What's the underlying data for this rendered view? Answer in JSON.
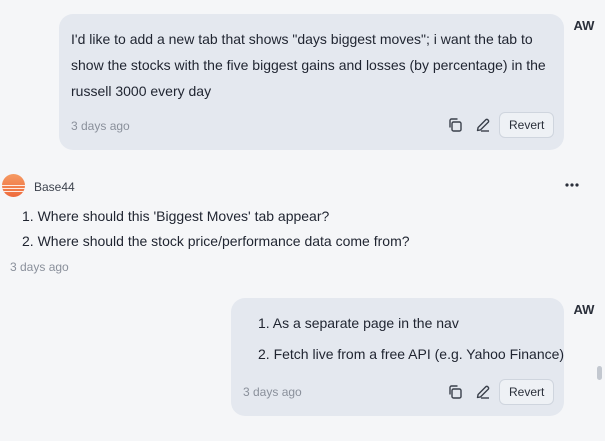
{
  "messages": [
    {
      "role": "user",
      "avatar": "AW",
      "lines": [
        "I'd like to add a new tab that shows \"days biggest moves\"; i want the tab to",
        "show the stocks with the five biggest gains and losses (by percentage) in the",
        "russell 3000 every day"
      ],
      "timestamp": "3 days ago",
      "actions": {
        "copy_icon": "copy-icon",
        "edit_icon": "pencil-icon",
        "revert_label": "Revert"
      }
    },
    {
      "role": "agent",
      "name": "Base44",
      "logo_color": "#f07a45",
      "items": [
        "1. Where should this 'Biggest Moves' tab appear?",
        "2. Where should the stock price/performance data come from?"
      ],
      "timestamp": "3 days ago",
      "more_icon": "more-horizontal-icon"
    },
    {
      "role": "user",
      "avatar": "AW",
      "items": [
        "1. As a separate page in the nav",
        "2. Fetch live from a free API (e.g. Yahoo Finance)"
      ],
      "timestamp": "3 days ago",
      "actions": {
        "copy_icon": "copy-icon",
        "edit_icon": "pencil-icon",
        "revert_label": "Revert"
      }
    }
  ],
  "colors": {
    "bubble": "#e4e8ef",
    "background": "#f5f6f8",
    "timestamp": "#8a909b"
  }
}
